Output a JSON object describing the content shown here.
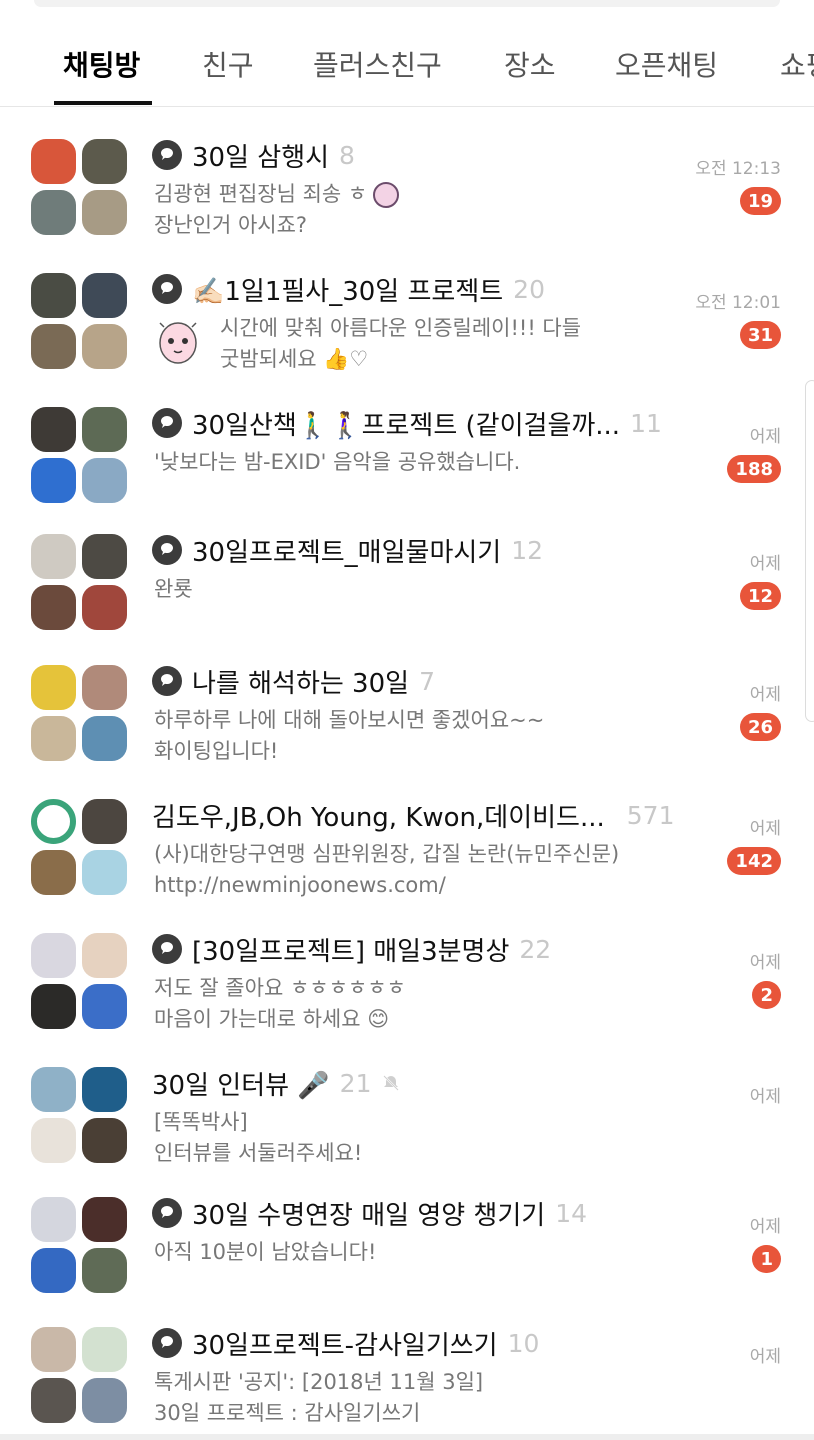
{
  "tabs": [
    {
      "label": "채팅방",
      "active": true
    },
    {
      "label": "친구",
      "active": false
    },
    {
      "label": "플러스친구",
      "active": false
    },
    {
      "label": "장소",
      "active": false
    },
    {
      "label": "오픈채팅",
      "active": false
    },
    {
      "label": "쇼핑",
      "active": false
    }
  ],
  "colors": {
    "badge": "#e8553a",
    "open_icon": "#3c3c3c",
    "tab_active": "#111111"
  },
  "chats": [
    {
      "title": "30일 삼행시",
      "count": "8",
      "open_chat": true,
      "preview1": "김광현 편집장님 죄송 ㅎ",
      "preview2": "장난인거 아시죠?",
      "time": "오전 12:13",
      "unread": "19"
    },
    {
      "title": "✍🏻1일1필사_30일 프로젝트",
      "count": "20",
      "open_chat": true,
      "preview1": "시간에 맞춰 아름다운 인증릴레이!!! 다들",
      "preview2": "굿밤되세요 👍♡",
      "time": "오전 12:01",
      "unread": "31",
      "sticker": "peach-sticker-icon"
    },
    {
      "title": "30일산책🚶‍♂️🚶‍♀️프로젝트 (같이걸을까...",
      "count": "11",
      "open_chat": true,
      "preview1": "'낮보다는 밤-EXID' 음악을 공유했습니다.",
      "preview2": "",
      "time": "어제",
      "unread": "188"
    },
    {
      "title": "30일프로젝트_매일물마시기",
      "count": "12",
      "open_chat": true,
      "preview1": "완룟",
      "preview2": "",
      "time": "어제",
      "unread": "12"
    },
    {
      "title": "나를 해석하는 30일",
      "count": "7",
      "open_chat": true,
      "preview1": "하루하루 나에 대해 돌아보시면 좋겠어요~~",
      "preview2": "화이팅입니다!",
      "time": "어제",
      "unread": "26"
    },
    {
      "title": "김도우,JB,Oh Young, Kwon,데이비드...",
      "count": "571",
      "open_chat": false,
      "preview1": "(사)대한당구연맹 심판위원장, 갑질 논란(뉴민주신문)",
      "preview2": "http://newminjoonews.com/",
      "time": "어제",
      "unread": "142"
    },
    {
      "title": "[30일프로젝트] 매일3분명상",
      "count": "22",
      "open_chat": true,
      "preview1": "저도 잘 졸아요 ㅎㅎㅎㅎㅎㅎ",
      "preview2": "마음이 가는대로 하세요 😊",
      "time": "어제",
      "unread": "2"
    },
    {
      "title": "30일 인터뷰 🎤",
      "count": "21",
      "open_chat": false,
      "muted": true,
      "preview1": "[똑똑박사]",
      "preview2": "인터뷰를 서둘러주세요!",
      "time": "어제",
      "unread": ""
    },
    {
      "title": "30일 수명연장 매일 영양 챙기기",
      "count": "14",
      "open_chat": true,
      "preview1": "아직 10분이 남았습니다!",
      "preview2": "",
      "time": "어제",
      "unread": "1"
    },
    {
      "title": "30일프로젝트-감사일기쓰기",
      "count": "10",
      "open_chat": true,
      "preview1": "톡게시판 '공지': [2018년 11월 3일]",
      "preview2": "30일 프로젝트 : 감사일기쓰기",
      "time": "어제",
      "unread": ""
    }
  ]
}
